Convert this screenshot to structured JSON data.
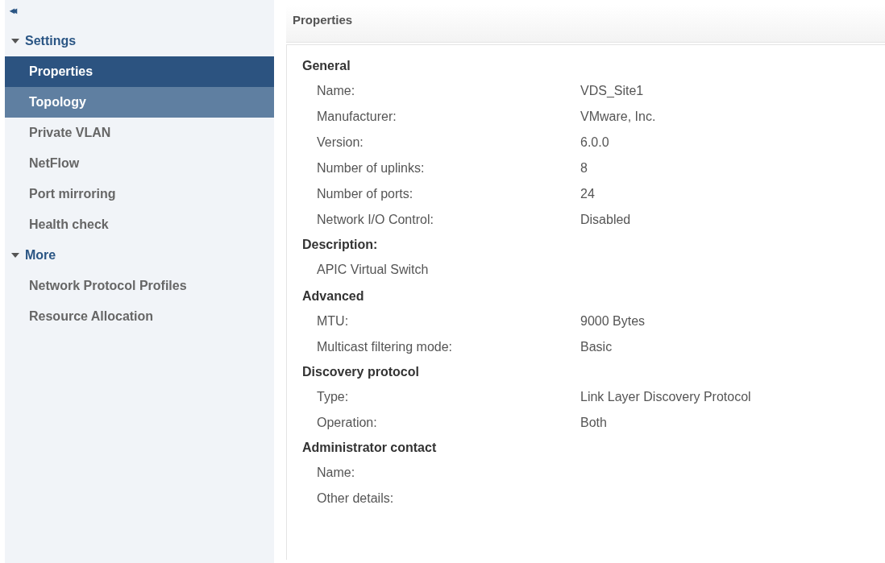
{
  "sidebar": {
    "collapse_icon": "◂◂",
    "groups": [
      {
        "label": "Settings",
        "expanded": true,
        "items": [
          {
            "label": "Properties",
            "selected": true,
            "highlighted": false
          },
          {
            "label": "Topology",
            "selected": false,
            "highlighted": true
          },
          {
            "label": "Private VLAN",
            "selected": false,
            "highlighted": false
          },
          {
            "label": "NetFlow",
            "selected": false,
            "highlighted": false
          },
          {
            "label": "Port mirroring",
            "selected": false,
            "highlighted": false
          },
          {
            "label": "Health check",
            "selected": false,
            "highlighted": false
          }
        ]
      },
      {
        "label": "More",
        "expanded": true,
        "items": [
          {
            "label": "Network Protocol Profiles",
            "selected": false,
            "highlighted": false
          },
          {
            "label": "Resource Allocation",
            "selected": false,
            "highlighted": false
          }
        ]
      }
    ]
  },
  "main": {
    "title": "Properties",
    "sections": [
      {
        "title": "General",
        "kind": "rows",
        "rows": [
          {
            "label": "Name:",
            "value": "VDS_Site1"
          },
          {
            "label": "Manufacturer:",
            "value": "VMware, Inc."
          },
          {
            "label": "Version:",
            "value": "6.0.0"
          },
          {
            "label": "Number of uplinks:",
            "value": "8"
          },
          {
            "label": "Number of ports:",
            "value": "24"
          },
          {
            "label": "Network I/O Control:",
            "value": "Disabled"
          }
        ]
      },
      {
        "title": "Description:",
        "kind": "text",
        "text": "APIC Virtual Switch"
      },
      {
        "title": "Advanced",
        "kind": "rows",
        "rows": [
          {
            "label": "MTU:",
            "value": "9000 Bytes"
          },
          {
            "label": "Multicast filtering mode:",
            "value": "Basic"
          }
        ]
      },
      {
        "title": "Discovery protocol",
        "kind": "rows",
        "rows": [
          {
            "label": "Type:",
            "value": "Link Layer Discovery Protocol"
          },
          {
            "label": "Operation:",
            "value": "Both"
          }
        ]
      },
      {
        "title": "Administrator contact",
        "kind": "rows",
        "rows": [
          {
            "label": "Name:"
          },
          {
            "label": "Other details:"
          }
        ]
      }
    ]
  }
}
